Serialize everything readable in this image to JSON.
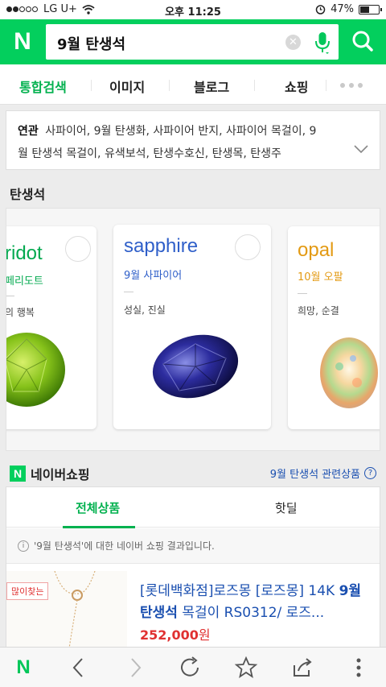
{
  "status_bar": {
    "carrier": "LG U+",
    "time": "오후 11:25",
    "battery": "47%"
  },
  "search": {
    "logo": "N",
    "query": "9월 탄생석"
  },
  "tabs": [
    {
      "label": "통합검색"
    },
    {
      "label": "이미지"
    },
    {
      "label": "블로그"
    },
    {
      "label": "쇼핑"
    }
  ],
  "related": {
    "title": "연관",
    "text_line1": "사파이어, 9월 탄생화, 사파이어 반지, 사파이어 목걸이, 9",
    "text_line2": "월 탄생석 목걸이, 유색보석, 탄생수호신, 탄생목, 탄생주"
  },
  "birthstone": {
    "section_title": "탄생석",
    "cards": [
      {
        "en": "ridot",
        "kr": "페리도트",
        "meaning": "의 행복",
        "color": "#03a94f"
      },
      {
        "en": "sapphire",
        "kr": "9월 사파이어",
        "meaning": "성실, 진실",
        "color": "#2f5fc9"
      },
      {
        "en": "opal",
        "kr": "10월 오팔",
        "meaning": "희망, 순결",
        "color": "#e39a13"
      }
    ]
  },
  "shopping": {
    "badge": "N",
    "title": "네이버쇼핑",
    "related_link": "9월 탄생석 관련상품",
    "help_icon": "?",
    "tabs": [
      {
        "label": "전체상품"
      },
      {
        "label": "핫딜"
      }
    ],
    "notice_icon": "i",
    "notice": "'9월 탄생석'에 대한 네이버 쇼핑 결과입니다.",
    "product": {
      "badge": "많이찾는",
      "title_prefix": "[롯데백화점]로즈몽 [로즈몽] 14K ",
      "title_bold": "9월 탄생석",
      "title_suffix": " 목걸이 RS0312/ 로즈...",
      "price": "252,000",
      "currency": "원"
    }
  },
  "bottom_bar": {
    "logo": "N"
  },
  "colors": {
    "brand_green": "#03cf5d",
    "link_blue": "#1a4fb0",
    "price_red": "#e03131"
  }
}
